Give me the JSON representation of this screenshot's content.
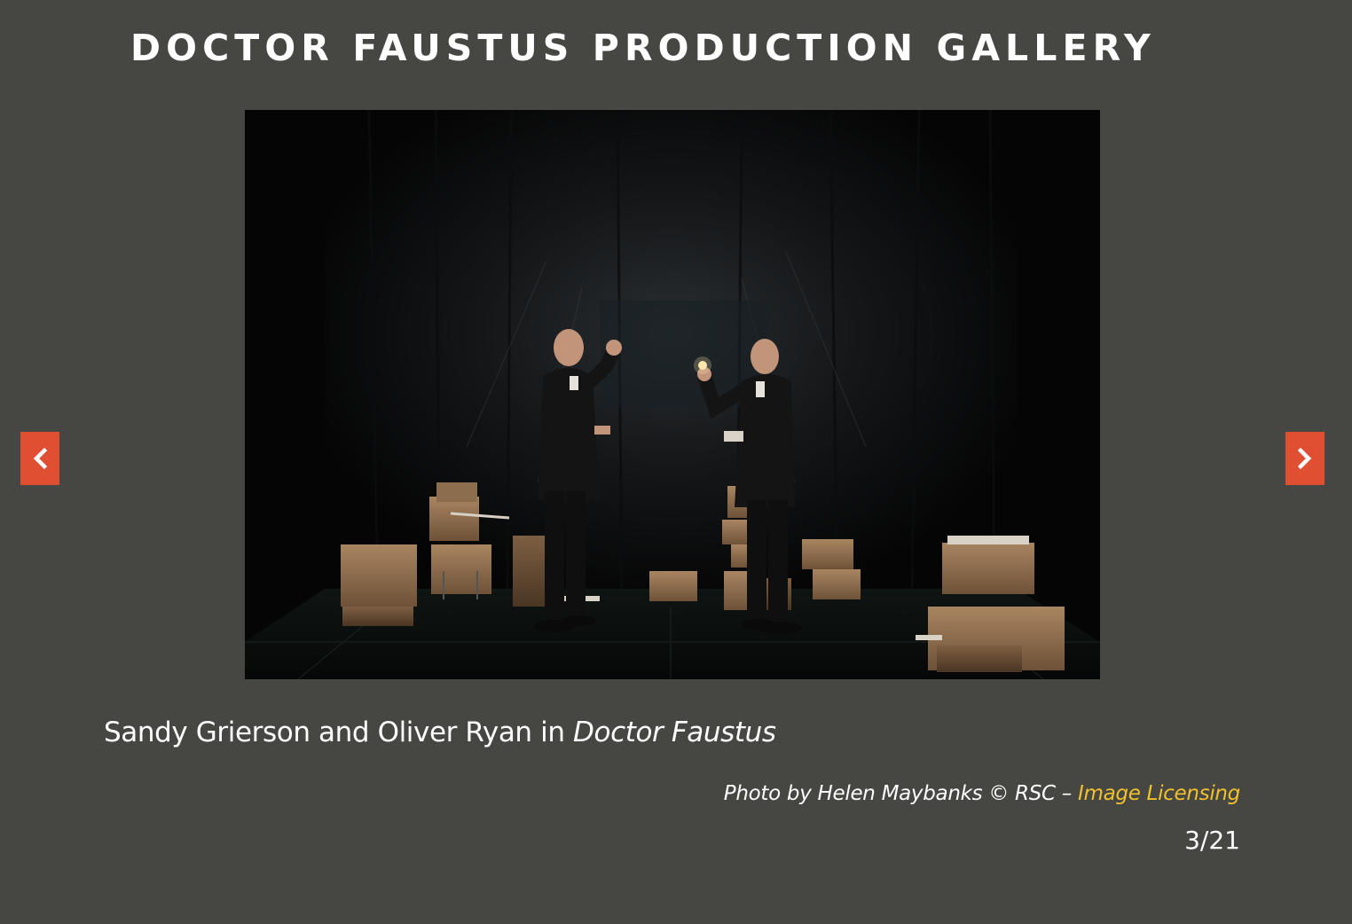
{
  "gallery": {
    "title": "DOCTOR FAUSTUS PRODUCTION GALLERY"
  },
  "slide": {
    "caption_prefix": "Sandy Grierson and Oliver Ryan in ",
    "caption_play_title": "Doctor Faustus",
    "credit_text": "Photo by Helen Maybanks © RSC – ",
    "licensing_link": "Image Licensing",
    "current_index": 3,
    "total": 21,
    "counter": "3/21"
  },
  "nav": {
    "prev_icon": "chevron-left-icon",
    "next_icon": "chevron-right-icon",
    "button_color": "#e04f32"
  },
  "colors": {
    "background": "#464742",
    "link": "#f2c12e",
    "text": "#ffffff"
  }
}
